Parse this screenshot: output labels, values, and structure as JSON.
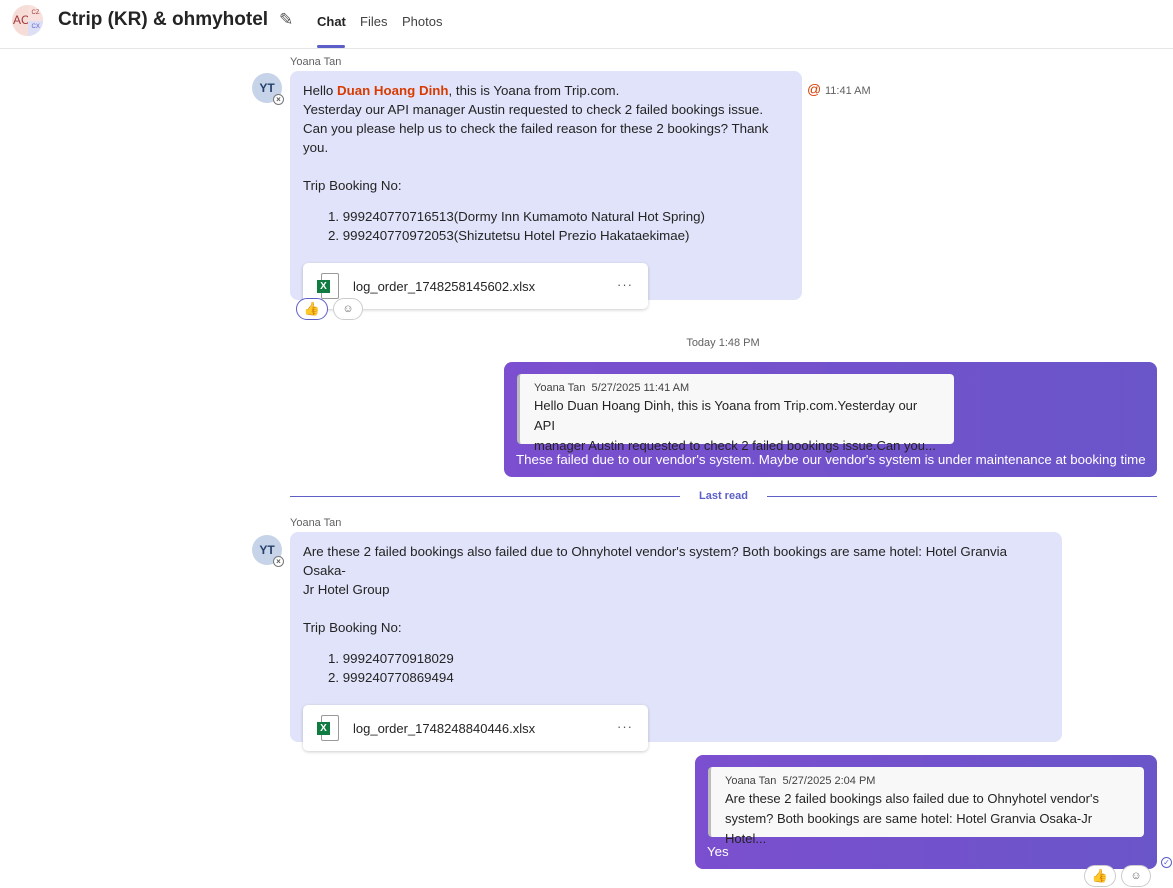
{
  "header": {
    "avatar_initials": "AC",
    "avatar_sub1": "CZ",
    "avatar_sub2": "CX",
    "title": "Ctrip (KR) & ohmyhotel",
    "tabs": [
      {
        "label": "Chat"
      },
      {
        "label": "Files"
      },
      {
        "label": "Photos"
      }
    ]
  },
  "messages": [
    {
      "sender": "Yoana Tan",
      "initials": "YT",
      "time": "11:41 AM",
      "greeting_pre": "Hello ",
      "mention": "Duan Hoang Dinh",
      "greeting_post": ", this is Yoana from Trip.com.",
      "lines": [
        "Yesterday our API manager Austin requested to check 2 failed bookings issue.",
        "Can you please help us to check the failed reason for these 2 bookings? Thank you."
      ],
      "label": "Trip Booking No:",
      "items": [
        "1. 999240770716513(Dormy Inn Kumamoto Natural Hot Spring)",
        "2. 999240770972053(Shizutetsu Hotel Prezio Hakataekimae)"
      ],
      "file": "log_order_1748258145602.xlsx"
    },
    {
      "divider": "Today 1:48 PM",
      "quote_sender": "Yoana Tan",
      "quote_time": "5/27/2025 11:41 AM",
      "quote_lines": [
        "Hello Duan Hoang Dinh, this is Yoana from Trip.com.Yesterday our API",
        "manager Austin requested to check 2 failed bookings issue.Can you..."
      ],
      "text": "These failed due to our vendor's system. Maybe our vendor's system is under maintenance at booking time"
    },
    {
      "last_read": "Last read"
    },
    {
      "sender": "Yoana Tan",
      "initials": "YT",
      "lines": [
        "Are these 2 failed bookings also failed due to Ohnyhotel vendor's system? Both bookings are same hotel: Hotel Granvia Osaka-",
        "Jr Hotel Group"
      ],
      "label": "Trip Booking No:",
      "items": [
        "1. 999240770918029",
        "2. 999240770869494"
      ],
      "file": "log_order_1748248840446.xlsx"
    },
    {
      "quote_sender": "Yoana Tan",
      "quote_time": "5/27/2025 2:04 PM",
      "quote_lines": [
        "Are these 2 failed bookings also failed due to Ohnyhotel vendor's",
        "system? Both bookings are same hotel: Hotel Granvia Osaka-Jr Hotel..."
      ],
      "text": "Yes"
    }
  ],
  "colors": {
    "accent": "#5b5fc7",
    "mention": "#d83b01",
    "bubble_in": "#e0e3f9",
    "bubble_out": "#7350cd"
  }
}
